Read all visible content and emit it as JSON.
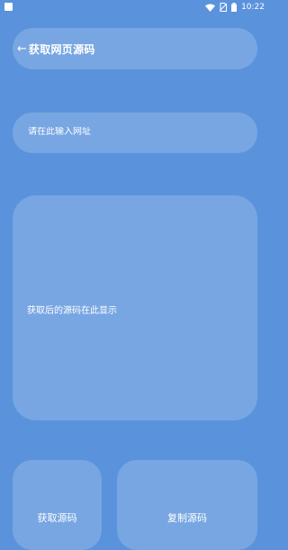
{
  "status_bar": {
    "time": "10:22",
    "icons": [
      "notification-square-icon",
      "wifi-icon",
      "no-sim-icon",
      "battery-icon"
    ]
  },
  "header": {
    "back_icon": "back-arrow-icon",
    "back_glyph": "←",
    "title": "获取网页源码"
  },
  "url_input": {
    "placeholder": "请在此输入网址",
    "value": ""
  },
  "source_display": {
    "placeholder_text": "获取后的源码在此显示"
  },
  "buttons": {
    "fetch_label": "获取源码",
    "copy_label": "复制源码"
  },
  "colors": {
    "background": "#5a93dc",
    "panel": "rgba(255,255,255,0.18)",
    "text": "#ffffff"
  }
}
